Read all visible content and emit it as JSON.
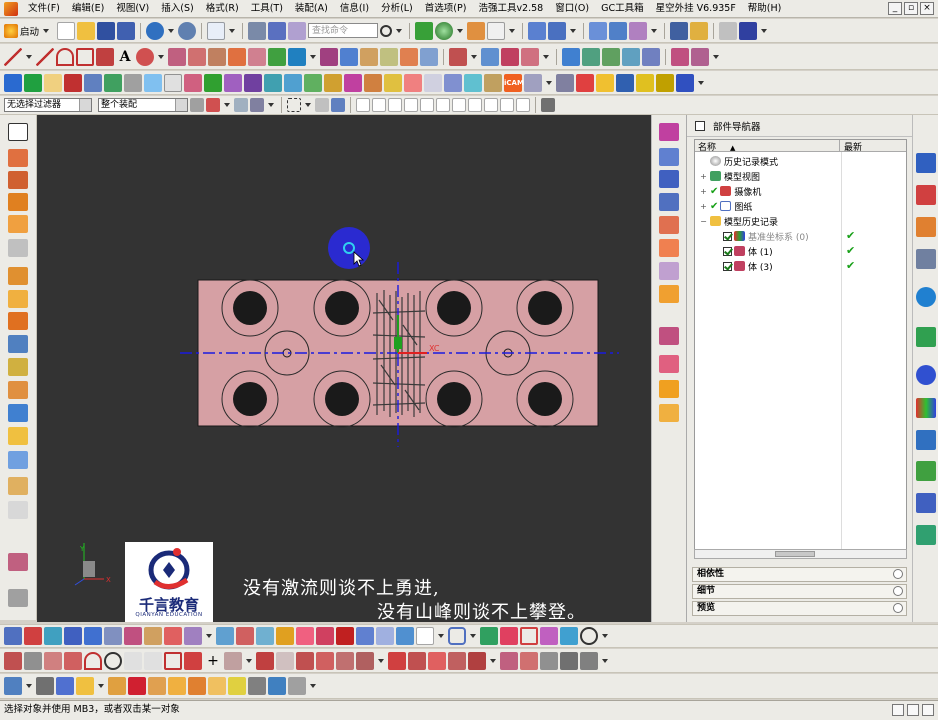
{
  "menubar": {
    "items": [
      "文件(F)",
      "编辑(E)",
      "视图(V)",
      "插入(S)",
      "格式(R)",
      "工具(T)",
      "装配(A)",
      "信息(I)",
      "分析(L)",
      "首选项(P)",
      "浩强工具v2.58",
      "窗口(O)",
      "GC工具箱",
      "星空外挂 V6.935F",
      "帮助(H)"
    ],
    "window_buttons": [
      "_",
      "▫",
      "×"
    ]
  },
  "toolbar": {
    "start_label": "启动",
    "search_placeholder": "查找命令"
  },
  "selbar": {
    "filter_value": "无选择过滤器",
    "assembly_value": "整个装配"
  },
  "navigator": {
    "title": "部件导航器",
    "col_name": "名称",
    "col_latest": "最新",
    "nodes": [
      {
        "label": "历史记录模式"
      },
      {
        "label": "模型视图"
      },
      {
        "label": "摄像机"
      },
      {
        "label": "图纸"
      },
      {
        "label": "模型历史记录"
      },
      {
        "label": "基准坐标系 (0)"
      },
      {
        "label": "体 (1)"
      },
      {
        "label": "体 (3)"
      }
    ],
    "check_glyph": "✔",
    "sections": [
      "相依性",
      "细节",
      "预览"
    ]
  },
  "viewport": {
    "axis_label": "XC",
    "triad_y": "Y",
    "triad_x": "X"
  },
  "logo": {
    "name": "千言教育",
    "english": "QIANYAN EDUCATION"
  },
  "subtitles": {
    "line1": "没有激流则谈不上勇进,",
    "line2": "没有山峰则谈不上攀登。"
  },
  "status_text": "选择对象并使用 MB3，或者双击某一对象",
  "colors": {
    "viewport_bg": "#333333",
    "part_fill": "#d6a0a4",
    "axis_blue": "#1a1ae0",
    "cursor_disc": "#2a2ad0"
  }
}
